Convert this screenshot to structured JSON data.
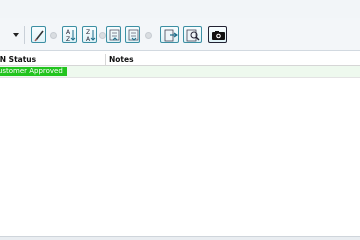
{
  "toolbar": {
    "icons": [
      "dropdown-arrow",
      "pencil-icon",
      "sort-az-icon",
      "sort-za-icon",
      "move-up-icon",
      "move-down-icon",
      "export-icon",
      "zoom-view-icon",
      "camera-icon"
    ]
  },
  "table": {
    "columns": [
      "RN Status",
      "Notes"
    ],
    "rows": [
      {
        "status": "Customer Approved",
        "notes": ""
      }
    ]
  },
  "colors": {
    "status_approved": "#22c41e",
    "row_bg": "#eef9ee",
    "button_border": "#3c8fa3"
  }
}
